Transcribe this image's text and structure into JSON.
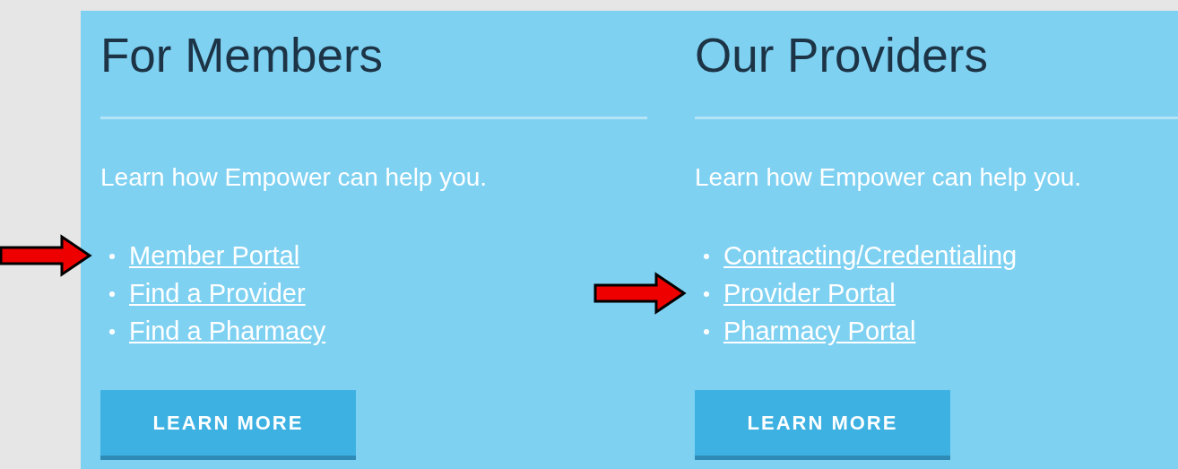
{
  "columns": [
    {
      "title": "For Members",
      "intro": "Learn how Empower can help you.",
      "links": [
        {
          "label": "Member Portal",
          "marked": true
        },
        {
          "label": "Find a Provider",
          "marked": false
        },
        {
          "label": "Find a Pharmacy",
          "marked": false
        }
      ],
      "button": "LEARN MORE"
    },
    {
      "title": "Our Providers",
      "intro": "Learn how Empower can help you.",
      "links": [
        {
          "label": "Contracting/Credentialing",
          "marked": false
        },
        {
          "label": "Provider Portal",
          "marked": true
        },
        {
          "label": "Pharmacy Portal",
          "marked": false
        }
      ],
      "button": "LEARN MORE"
    }
  ]
}
